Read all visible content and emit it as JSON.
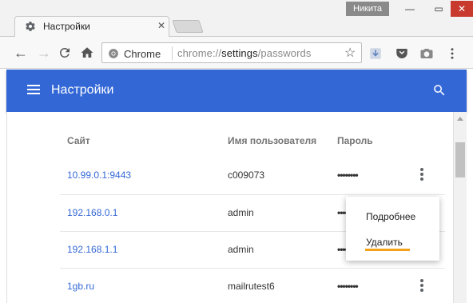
{
  "window": {
    "profile_name": "Никита",
    "minimize": "—",
    "maximize": "▭",
    "close": "✕"
  },
  "tab": {
    "title": "Настройки",
    "icon": "gear-icon",
    "close": "✕"
  },
  "toolbar": {
    "back": "←",
    "forward": "→",
    "reload": "C",
    "home": "⌂",
    "chip_label": "Chrome",
    "url_scheme": "chrome://",
    "url_host": "settings",
    "url_path": "/passwords",
    "bookmark": "☆"
  },
  "header": {
    "title": "Настройки"
  },
  "table": {
    "columns": [
      "Сайт",
      "Имя пользователя",
      "Пароль"
    ],
    "rows": [
      {
        "site": "10.99.0.1:9443",
        "user": "c009073",
        "password": "••••••••"
      },
      {
        "site": "192.168.0.1",
        "user": "admin",
        "password": "••••••••"
      },
      {
        "site": "192.168.1.1",
        "user": "admin",
        "password": "••••••••"
      },
      {
        "site": "1gb.ru",
        "user": "mailrutest6",
        "password": "••••••••"
      }
    ]
  },
  "menu": {
    "details": "Подробнее",
    "delete": "Удалить"
  },
  "colors": {
    "header": "#3367d6",
    "link": "#3367d6",
    "highlight": "#f3a21a",
    "close": "#c8392e"
  }
}
